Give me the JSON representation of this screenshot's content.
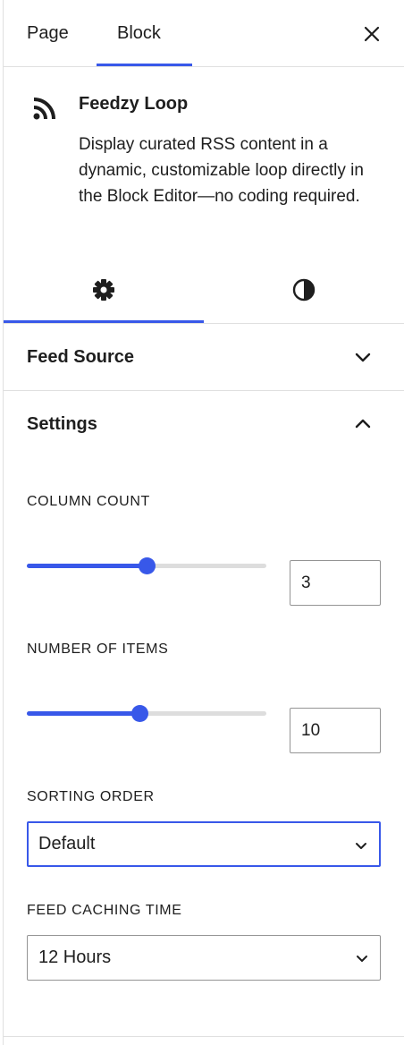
{
  "tabs": {
    "page": "Page",
    "block": "Block"
  },
  "block": {
    "title": "Feedzy Loop",
    "description": "Display curated RSS content in a dynamic, customizable loop directly in the Block Editor—no coding required."
  },
  "icon_tabs": [
    "settings-icon",
    "styles-icon"
  ],
  "panels": {
    "feed_source": {
      "title": "Feed Source",
      "expanded": false
    },
    "settings": {
      "title": "Settings",
      "expanded": true
    }
  },
  "settings": {
    "column_count": {
      "label": "COLUMN COUNT",
      "value": "3",
      "slider_fraction": 0.5
    },
    "number_of_items": {
      "label": "NUMBER OF ITEMS",
      "value": "10",
      "slider_fraction": 0.47
    },
    "sorting_order": {
      "label": "SORTING ORDER",
      "value": "Default"
    },
    "feed_caching_time": {
      "label": "FEED CACHING TIME",
      "value": "12 Hours"
    }
  },
  "colors": {
    "accent": "#3858e9",
    "border": "#e0e0e0",
    "text": "#1e1e1e"
  }
}
